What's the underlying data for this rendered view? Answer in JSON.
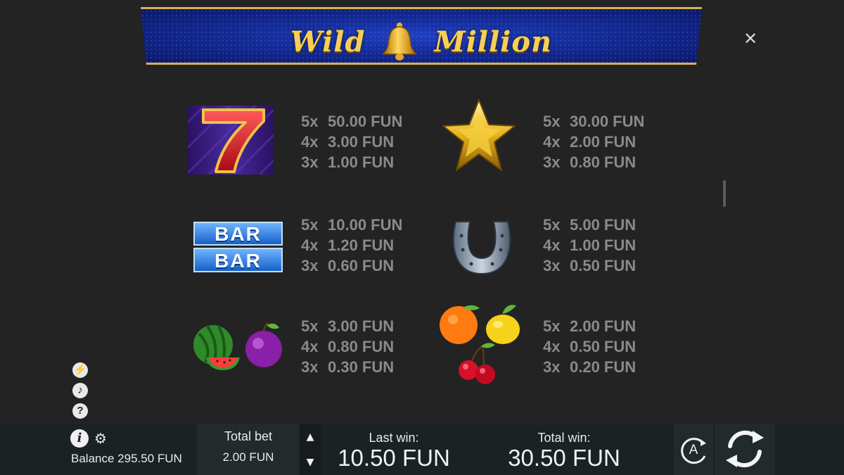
{
  "header": {
    "title_left": "Wild",
    "title_right": "Million",
    "close_glyph": "✕"
  },
  "paytable": [
    {
      "symbol": "seven",
      "icon": "seven-icon",
      "pays": [
        {
          "m": "5x",
          "v": "50.00 FUN"
        },
        {
          "m": "4x",
          "v": "3.00 FUN"
        },
        {
          "m": "3x",
          "v": "1.00 FUN"
        }
      ]
    },
    {
      "symbol": "star",
      "icon": "star-icon",
      "pays": [
        {
          "m": "5x",
          "v": "30.00 FUN"
        },
        {
          "m": "4x",
          "v": "2.00 FUN"
        },
        {
          "m": "3x",
          "v": "0.80 FUN"
        }
      ]
    },
    {
      "symbol": "bar",
      "icon": "bar-icon",
      "bar_text": "BAR",
      "pays": [
        {
          "m": "5x",
          "v": "10.00 FUN"
        },
        {
          "m": "4x",
          "v": "1.20 FUN"
        },
        {
          "m": "3x",
          "v": "0.60 FUN"
        }
      ]
    },
    {
      "symbol": "horseshoe",
      "icon": "horseshoe-icon",
      "pays": [
        {
          "m": "5x",
          "v": "5.00 FUN"
        },
        {
          "m": "4x",
          "v": "1.00 FUN"
        },
        {
          "m": "3x",
          "v": "0.50 FUN"
        }
      ]
    },
    {
      "symbol": "watermelon-plum",
      "icon": "watermelon-plum-icon",
      "pays": [
        {
          "m": "5x",
          "v": "3.00 FUN"
        },
        {
          "m": "4x",
          "v": "0.80 FUN"
        },
        {
          "m": "3x",
          "v": "0.30 FUN"
        }
      ]
    },
    {
      "symbol": "orange-lemon-cherry",
      "icon": "fruits-icon",
      "pays": [
        {
          "m": "5x",
          "v": "2.00 FUN"
        },
        {
          "m": "4x",
          "v": "0.50 FUN"
        },
        {
          "m": "3x",
          "v": "0.20 FUN"
        }
      ]
    }
  ],
  "side_icons": {
    "turbo": "⚡",
    "sound": "♪",
    "help": "?"
  },
  "bottom": {
    "balance": "Balance 295.50 FUN",
    "total_bet_label": "Total bet",
    "total_bet_value": "2.00 FUN",
    "last_win_label": "Last win:",
    "last_win_value": "10.50 FUN",
    "total_win_label": "Total win:",
    "total_win_value": "30.50 FUN",
    "autoplay_label": "A",
    "info_glyph": "i",
    "gear_glyph": "⚙",
    "up_glyph": "▲",
    "down_glyph": "▼"
  },
  "colors": {
    "background": "#232323",
    "banner": "#142b96",
    "gold": "#f7cf55",
    "pay_text": "#8a8a8a",
    "bottom_bar": "#1a2223"
  }
}
